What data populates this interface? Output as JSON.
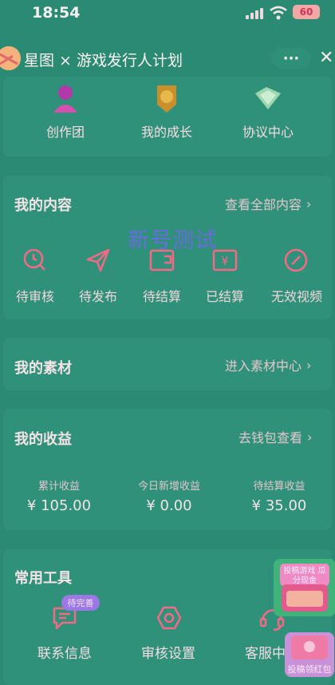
{
  "status_bar": {
    "time": "18:54",
    "battery": "60"
  },
  "nav": {
    "title": "星图 × 游戏发行人计划",
    "more": "···",
    "close": "✕"
  },
  "top_features": [
    {
      "label": "创作团",
      "icon": "person-icon"
    },
    {
      "label": "我的成长",
      "icon": "medal-icon"
    },
    {
      "label": "协议中心",
      "icon": "handshake-icon"
    }
  ],
  "watermark": "新号测试",
  "my_content": {
    "title": "我的内容",
    "link": "查看全部内容",
    "items": [
      {
        "label": "待审核",
        "icon": "clock-search-icon"
      },
      {
        "label": "待发布",
        "icon": "send-icon"
      },
      {
        "label": "待结算",
        "icon": "wallet-icon"
      },
      {
        "label": "已结算",
        "icon": "yen-receipt-icon"
      },
      {
        "label": "无效视频",
        "icon": "invalid-icon"
      }
    ]
  },
  "my_materials": {
    "title": "我的素材",
    "link": "进入素材中心"
  },
  "my_earnings": {
    "title": "我的收益",
    "link": "去钱包查看",
    "stats": [
      {
        "label": "累计收益",
        "value": "¥ 105.00"
      },
      {
        "label": "今日新增收益",
        "value": "¥ 0.00"
      },
      {
        "label": "待结算收益",
        "value": "¥ 35.00"
      }
    ]
  },
  "tools": {
    "title": "常用工具",
    "badge": "待完善",
    "items": [
      {
        "label": "联系信息",
        "icon": "message-icon"
      },
      {
        "label": "审核设置",
        "icon": "hexagon-settings-icon"
      },
      {
        "label": "客服中心",
        "icon": "headset-icon"
      }
    ]
  },
  "floating": {
    "promo_text": "投稿游戏 瓜分现金",
    "red_packet_label": "投稿领红包"
  },
  "colors": {
    "background": "#2a8a72",
    "card": "#2f9179",
    "accent": "#f36a86",
    "text": "#f5e3e6"
  }
}
